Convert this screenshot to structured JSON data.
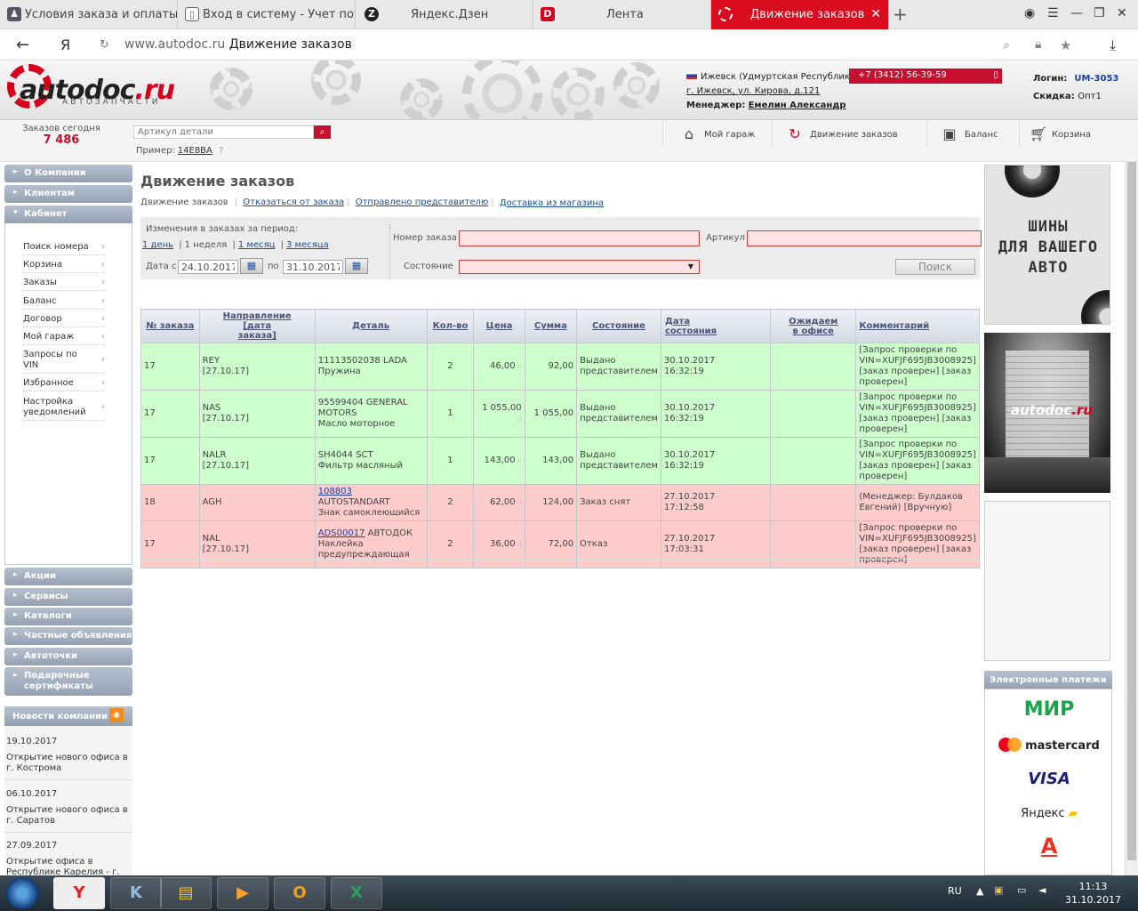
{
  "browser": {
    "tabs": [
      {
        "title": "Условия заказа и оплаты в",
        "icon": "person-icon",
        "active": false
      },
      {
        "title": "Вход в систему - Учет потр",
        "icon": "page-icon",
        "active": false
      },
      {
        "title": "Яндекс.Дзен",
        "icon": "zen-icon",
        "active": false
      },
      {
        "title": "Лента",
        "icon": "d-logo-icon",
        "active": false
      },
      {
        "title": "Движение заказов",
        "icon": "autodoc-icon",
        "active": true
      }
    ],
    "yandex_letter": "Я",
    "url_domain": "www.autodoc.ru",
    "url_title": "Движение заказов"
  },
  "header": {
    "logo_word_1": "autodoc",
    "logo_word_2": ".ru",
    "logo_sub": "АВТОЗАПЧАСТИ",
    "city": "Ижевск (Удмуртская Республика)",
    "address": "г. Ижевск, ул. Кирова, д.121",
    "manager_label": "Менеджер:",
    "manager_name": "Емелин Александр",
    "phone": "+7 (3412) 56-39-59",
    "login_label": "Логин:",
    "login_value": "UM-3053",
    "discount_label": "Скидка:",
    "discount_value": "Опт1"
  },
  "toolbar": {
    "orders_today_label": "Заказов сегодня",
    "orders_today_value": "7 486",
    "search_placeholder": "Артикул детали",
    "example_label": "Пример:",
    "example_value": "14E8BA",
    "nav": [
      {
        "label": "Мой гараж",
        "icon": "garage-icon"
      },
      {
        "label": "Движение заказов",
        "icon": "orders-flow-icon"
      },
      {
        "label": "Баланс",
        "icon": "wallet-icon"
      },
      {
        "label": "Корзина",
        "icon": "cart-icon"
      }
    ]
  },
  "sidebar": {
    "top_buttons": [
      "О Компании",
      "Клиентам",
      "Кабинет"
    ],
    "cabinet_items": [
      "Поиск номера",
      "Корзина",
      "Заказы",
      "Баланс",
      "Договор",
      "Мой гараж",
      "Запросы по VIN",
      "Избранное",
      "Настройка уведомлений"
    ],
    "bottom_buttons": [
      "Акции",
      "Сервисы",
      "Каталоги",
      "Частные объявления",
      "Автоточки",
      "Подарочные сертификаты"
    ],
    "news_title": "Новости компании",
    "news": [
      {
        "date": "19.10.2017",
        "text": "Открытие нового офиса в г. Кострома"
      },
      {
        "date": "06.10.2017",
        "text": "Открытие нового офиса в г. Саратов"
      },
      {
        "date": "27.09.2017",
        "text": "Открытие офиса в Республике Карелия - г."
      }
    ]
  },
  "main": {
    "title": "Движение заказов",
    "subnav": {
      "current": "Движение заказов",
      "links": [
        "Отказаться от заказа",
        "Отправлено представителю",
        "Доставка из магазина"
      ]
    },
    "filter": {
      "period_label": "Изменения в заказах за период:",
      "periods": [
        "1 день",
        "1 неделя",
        "1 месяц",
        "3 месяца"
      ],
      "date_from_label": "Дата с",
      "date_from": "24.10.2017",
      "date_to_label": "по",
      "date_to": "31.10.2017",
      "order_number_label": "Номер заказа",
      "article_label": "Артикул",
      "state_label": "Состояние",
      "search_button": "Поиск"
    },
    "table": {
      "headers": [
        "№ заказа",
        "Направление [дата заказа]",
        "Деталь",
        "Кол-во",
        "Цена",
        "Сумма",
        "Состояние",
        "Дата состояния",
        "Ожидаем в офисе",
        "Комментарий"
      ],
      "rows": [
        {
          "status_color": "green",
          "order": "17",
          "direction": "REY",
          "order_date": "[27.10.17]",
          "part_link": "",
          "part_line1": "11113502038 LADA",
          "part_line2": "Пружина",
          "qty": "2",
          "price": "46,00",
          "sum": "92,00",
          "state": "Выдано представителем",
          "state_date": "30.10.2017",
          "state_time": "16:32:19",
          "expected": "",
          "comment": "[Запрос проверки по VIN=XUFJF695JB3008925] [заказ проверен] [заказ проверен]"
        },
        {
          "status_color": "green",
          "order": "17",
          "direction": "NAS",
          "order_date": "[27.10.17]",
          "part_link": "",
          "part_line1": "95599404 GENERAL MOTORS",
          "part_line2": "Масло моторное",
          "qty": "1",
          "price": "1 055,00",
          "sum": "1 055,00",
          "state": "Выдано представителем",
          "state_date": "30.10.2017",
          "state_time": "16:32:19",
          "expected": "",
          "comment": "[Запрос проверки по VIN=XUFJF695JB3008925] [заказ проверен] [заказ проверен]"
        },
        {
          "status_color": "green",
          "order": "17",
          "direction": "NALR",
          "order_date": "[27.10.17]",
          "part_link": "",
          "part_line1": "SH4044 SCT",
          "part_line2": "Фильтр масляный",
          "qty": "1",
          "price": "143,00",
          "sum": "143,00",
          "state": "Выдано представителем",
          "state_date": "30.10.2017",
          "state_time": "16:32:19",
          "expected": "",
          "comment": "[Запрос проверки по VIN=XUFJF695JB3008925] [заказ проверен] [заказ проверен]"
        },
        {
          "status_color": "red",
          "order": "18",
          "direction": "AGH",
          "order_date": "",
          "part_link": "108803",
          "part_line1": "AUTOSTANDART",
          "part_line2": "Знак самоклеющийся",
          "qty": "2",
          "price": "62,00",
          "sum": "124,00",
          "state": "Заказ снят",
          "state_date": "27.10.2017",
          "state_time": "17:12:58",
          "expected": "",
          "comment": "(Менеджер: Булдаков Евгений) [Вручную]"
        },
        {
          "status_color": "red",
          "order": "17",
          "direction": "NAL",
          "order_date": "[27.10.17]",
          "part_link": "ADS00017",
          "part_line1": "АВТОДОК",
          "part_line2": "Наклейка предупреждающая",
          "qty": "2",
          "price": "36,00",
          "sum": "72,00",
          "state": "Отказ",
          "state_date": "27.10.2017",
          "state_time": "17:03:31",
          "expected": "",
          "comment": "[Запрос проверки по VIN=XUFJF695JB3008925] [заказ проверен] [заказ проверен]"
        }
      ]
    }
  },
  "right": {
    "tires_banner": [
      "ШИНЫ",
      "ДЛЯ ВАШЕГО",
      "АВТО"
    ],
    "payments_title": "Электронные платежи",
    "payments": [
      "МИР",
      "mastercard",
      "VISA",
      "Яндекс",
      "А"
    ]
  },
  "taskbar": {
    "lang": "RU",
    "time": "11:13",
    "date": "31.10.2017"
  },
  "colors": {
    "accent_red": "#c8102e",
    "row_ok": "#ccffcc",
    "row_bad": "#ffcccc",
    "sidebar_btn": "#a3aebf"
  }
}
